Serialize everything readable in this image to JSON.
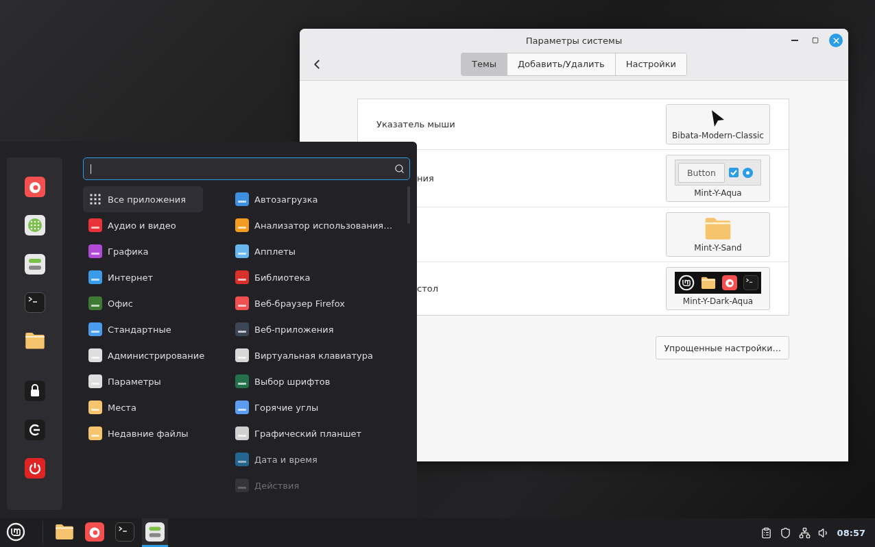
{
  "settings_window": {
    "title": "Параметры системы",
    "tabs": [
      {
        "label": "Темы",
        "selected": true
      },
      {
        "label": "Добавить/Удалить",
        "selected": false
      },
      {
        "label": "Настройки",
        "selected": false
      }
    ],
    "theme_rows": [
      {
        "kind": "cursor",
        "label": "Указатель мыши",
        "partly_hidden": false,
        "preview": "Bibata-Modern-Classic"
      },
      {
        "kind": "controls",
        "label": "ния",
        "partly_hidden": true,
        "preview": "Mint-Y-Aqua",
        "preview_button": "Button"
      },
      {
        "kind": "icons",
        "preview": "Mint-Y-Sand"
      },
      {
        "kind": "desktop",
        "label": "стол",
        "partly_hidden": true,
        "preview": "Mint-Y-Dark-Aqua"
      }
    ],
    "simple_settings_button": "Упрощенные настройки…"
  },
  "menu": {
    "categories": [
      {
        "label": "Все приложения",
        "selected": true
      },
      {
        "label": "Аудио и видео",
        "selected": false
      },
      {
        "label": "Графика",
        "selected": false
      },
      {
        "label": "Интернет",
        "selected": false
      },
      {
        "label": "Офис",
        "selected": false
      },
      {
        "label": "Стандартные",
        "selected": false
      },
      {
        "label": "Администрирование",
        "selected": false
      },
      {
        "label": "Параметры",
        "selected": false
      },
      {
        "label": "Места",
        "selected": false
      },
      {
        "label": "Недавние файлы",
        "selected": false
      }
    ],
    "apps": [
      "Автозагрузка",
      "Анализатор использования…",
      "Апплеты",
      "Библиотека",
      "Веб-браузер Firefox",
      "Веб-приложения",
      "Виртуальная клавиатура",
      "Выбор шрифтов",
      "Горячие углы",
      "Графический планшет",
      "Дата и время",
      "Действия"
    ]
  },
  "taskbar": {
    "apps": [
      {
        "selected": false
      },
      {
        "selected": false
      },
      {
        "selected": false
      },
      {
        "selected": true
      }
    ],
    "clock": "08:57"
  }
}
